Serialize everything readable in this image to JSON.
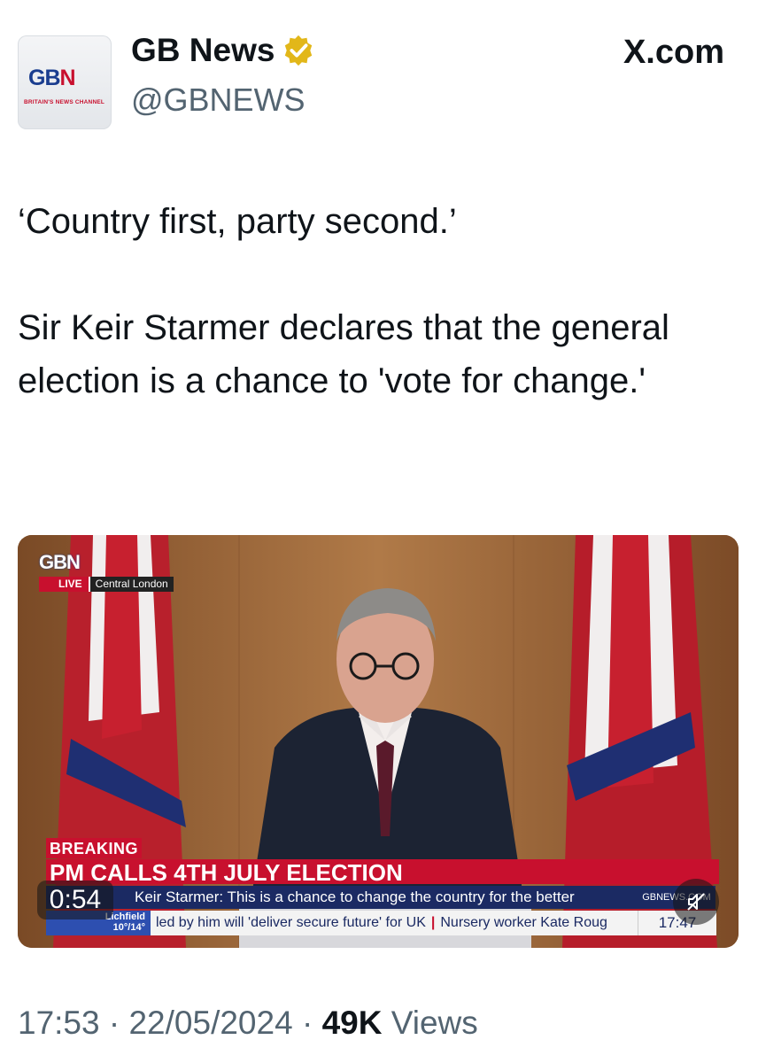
{
  "colors": {
    "brand_red": "#c8102e",
    "brand_blue": "#1b2a63",
    "verified_gold": "#e2b719",
    "secondary_text": "#536471"
  },
  "header": {
    "avatar": {
      "logo_text": "GBN",
      "tagline": "BRITAIN'S NEWS CHANNEL"
    },
    "display_name": "GB News",
    "verified_badge": "gold-check-icon",
    "handle": "@GBNEWS",
    "site": "X.com"
  },
  "tweet": {
    "text": "‘Country first, party second.’\n\nSir Keir Starmer declares that the general election is a chance to 'vote for change.'"
  },
  "video": {
    "channel_logo": "GBN",
    "live_label": "LIVE",
    "location": "Central London",
    "breaking_label": "BREAKING",
    "headline": "PM CALLS 4TH JULY ELECTION",
    "quote": "Keir Starmer: This is a chance to change the country for the better",
    "site_url": "GBNEWS.COM",
    "weather": {
      "city": "Lichfield",
      "temps": "10°/14°"
    },
    "ticker_items": [
      "led by him will 'deliver secure future' for UK",
      "Nursery worker Kate Roug"
    ],
    "clock": "17:47",
    "duration": "0:54",
    "mute_icon": "muted-speaker-icon"
  },
  "footer": {
    "time": "17:53",
    "date": "22/05/2024",
    "separator": "·",
    "views_count": "49K",
    "views_label": "Views"
  }
}
